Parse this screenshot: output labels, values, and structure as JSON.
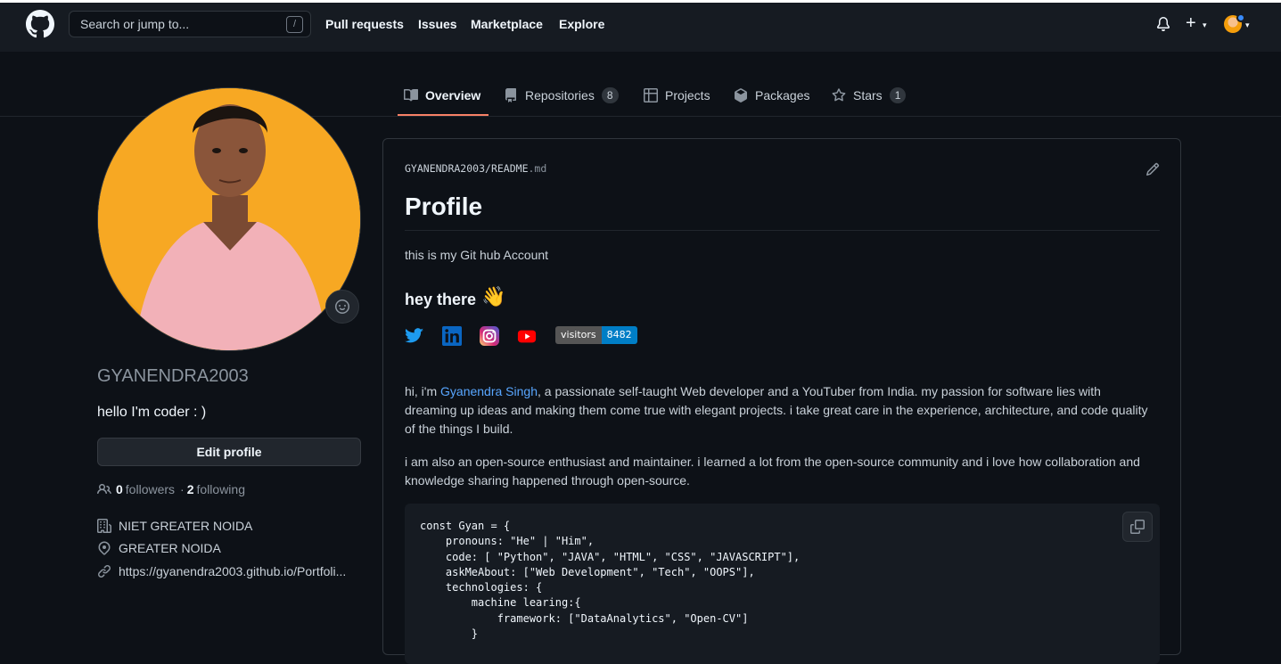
{
  "header": {
    "search_placeholder": "Search or jump to...",
    "search_shortcut": "/",
    "nav": [
      "Pull requests",
      "Issues",
      "Marketplace",
      "Explore"
    ],
    "plus_symbol": "+",
    "caret_symbol": "▾"
  },
  "tabs": [
    {
      "label": "Overview",
      "icon": "book-icon",
      "active": true
    },
    {
      "label": "Repositories",
      "icon": "repo-icon",
      "count": "8"
    },
    {
      "label": "Projects",
      "icon": "table-icon"
    },
    {
      "label": "Packages",
      "icon": "package-icon"
    },
    {
      "label": "Stars",
      "icon": "star-icon",
      "count": "1"
    }
  ],
  "profile": {
    "username": "GYANENDRA2003",
    "bio": "hello I'm coder : )",
    "edit_label": "Edit profile",
    "followers": "0",
    "followers_label": "followers",
    "separator": "·",
    "following": "2",
    "following_label": "following",
    "company": "NIET GREATER NOIDA",
    "location": "GREATER NOIDA",
    "website": "https://gyanendra2003.github.io/Portfoli..."
  },
  "readme": {
    "owner": "GYANENDRA2003",
    "slash": "/",
    "file": "README",
    "ext": ".md",
    "title": "Profile",
    "intro": "this is my Git hub Account",
    "greeting": "hey there",
    "wave": "👋",
    "badge_label": "visitors",
    "badge_value": "8482",
    "about_prefix": "hi, i'm ",
    "about_name": "Gyanendra Singh",
    "about_rest": ", a passionate self-taught Web developer and a YouTuber from India. my passion for software lies with dreaming up ideas and making them come true with elegant projects. i take great care in the experience, architecture, and code quality of the things I build.",
    "oss": "i am also an open-source enthusiast and maintainer. i learned a lot from the open-source community and i love how collaboration and knowledge sharing happened through open-source.",
    "code": "const Gyan = {\n    pronouns: \"He\" | \"Him\",\n    code: [ \"Python\", \"JAVA\", \"HTML\", \"CSS\", \"JAVASCRIPT\"],\n    askMeAbout: [\"Web Development\", \"Tech\", \"OOPS\"],\n    technologies: {\n        machine learing:{\n            framework: [\"DataAnalytics\", \"Open-CV\"]\n        }"
  },
  "colors": {
    "accent_tab": "#f78166",
    "link": "#58a6ff",
    "avatar_bg": "#f5a31a"
  }
}
